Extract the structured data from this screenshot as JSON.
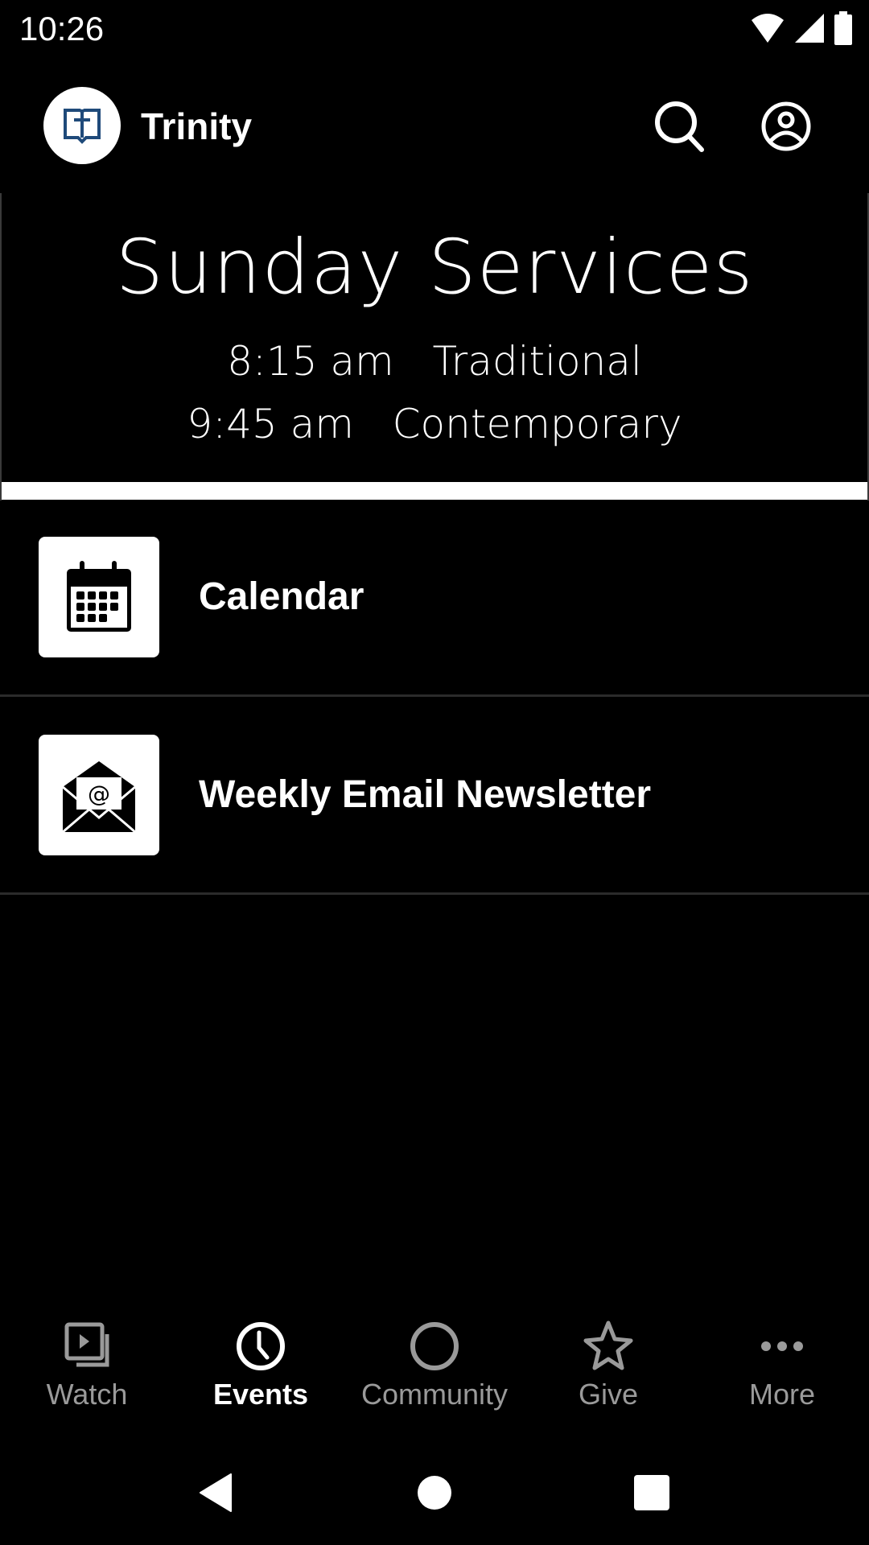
{
  "status_bar": {
    "time": "10:26",
    "icons": [
      "wifi-icon",
      "cellular-signal-icon",
      "battery-icon"
    ]
  },
  "app_bar": {
    "title": "Trinity",
    "logo_icon": "bible-cross-icon",
    "actions": [
      "search-icon",
      "account-circle-icon"
    ]
  },
  "banner": {
    "title": "Sunday Services",
    "services": [
      {
        "time": "8:15 am",
        "name": "Traditional"
      },
      {
        "time": "9:45 am",
        "name": "Contemporary"
      }
    ]
  },
  "list": {
    "items": [
      {
        "label": "Calendar",
        "icon": "calendar-icon"
      },
      {
        "label": "Weekly Email Newsletter",
        "icon": "email-envelope-icon"
      }
    ]
  },
  "tabs": [
    {
      "label": "Watch",
      "icon": "video-library-icon",
      "active": false
    },
    {
      "label": "Events",
      "icon": "clock-icon",
      "active": true
    },
    {
      "label": "Community",
      "icon": "circle-icon",
      "active": false
    },
    {
      "label": "Give",
      "icon": "star-icon",
      "active": false
    },
    {
      "label": "More",
      "icon": "more-horizontal-icon",
      "active": false
    }
  ],
  "nav_bar": {
    "buttons": [
      "back",
      "home",
      "recents"
    ]
  },
  "colors": {
    "background": "#000000",
    "logo_blue": "#1f4a7a",
    "inactive_tab": "#9a9a9a",
    "active_tab": "#ffffff"
  }
}
